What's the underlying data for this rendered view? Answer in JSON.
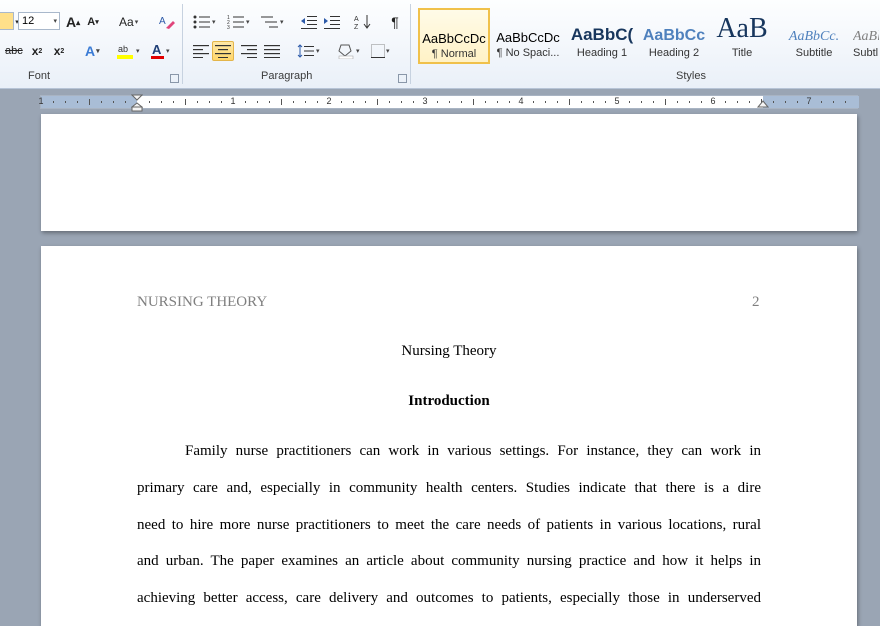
{
  "ribbon": {
    "font_size": "12",
    "groups": {
      "font": "Font",
      "paragraph": "Paragraph",
      "styles": "Styles"
    },
    "styles": [
      {
        "preview": "AaBbCcDc",
        "name": "¶ Normal"
      },
      {
        "preview": "AaBbCcDc",
        "name": "¶ No Spaci..."
      },
      {
        "preview": "AaBbC(",
        "name": "Heading 1"
      },
      {
        "preview": "AaBbCc",
        "name": "Heading 2"
      },
      {
        "preview": "AaB",
        "name": "Title"
      },
      {
        "preview": "AaBbCc.",
        "name": "Subtitle"
      },
      {
        "preview": "AaBl",
        "name": "Subtl"
      }
    ],
    "colors": {
      "accent": "#f0c14b",
      "highlight": "#ffff00",
      "font_color": "#e00000",
      "heading_blue": "#17365d"
    }
  },
  "ruler": {
    "numbers": [
      "1",
      "1",
      "2",
      "3",
      "4",
      "5",
      "6",
      "7"
    ]
  },
  "document": {
    "header_left": "NURSING THEORY",
    "page_number": "2",
    "title": "Nursing Theory",
    "heading": "Introduction",
    "lines": [
      "Family nurse practitioners can work in various settings. For instance, they can work in",
      "primary care and, especially in community health centers. Studies indicate that there is a dire",
      "need to hire more nurse practitioners to meet the care needs of patients in various locations, rural",
      "and urban. The paper examines an article about community nursing practice and how it helps in",
      "achieving better access, care delivery and outcomes to patients, especially those in underserved"
    ]
  }
}
